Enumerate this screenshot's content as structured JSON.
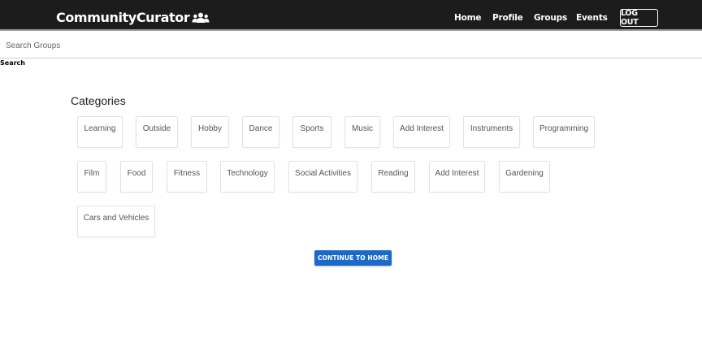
{
  "navbar": {
    "brand": "CommunityCurator",
    "brand_icon": "users-icon",
    "links": {
      "home": "Home",
      "profile": "Profile",
      "groups": "Groups",
      "events": "Events"
    },
    "logout": "LOG OUT"
  },
  "search": {
    "placeholder": "Search Groups",
    "value": "",
    "label": "Search"
  },
  "categories": {
    "title": "Categories",
    "items": [
      "Learning",
      "Outside",
      "Hobby",
      "Dance",
      "Sports",
      "Music",
      "Add Interest",
      "Instruments",
      "Programming",
      "Film",
      "Food",
      "Fitness",
      "Technology",
      "Social Activities",
      "Reading",
      "Add Interest",
      "Gardening",
      "Cars and Vehicles"
    ]
  },
  "continue_button": "CONTINUE TO HOME",
  "colors": {
    "navbar": "#1c1c1c",
    "accent": "#1a6bc8"
  }
}
